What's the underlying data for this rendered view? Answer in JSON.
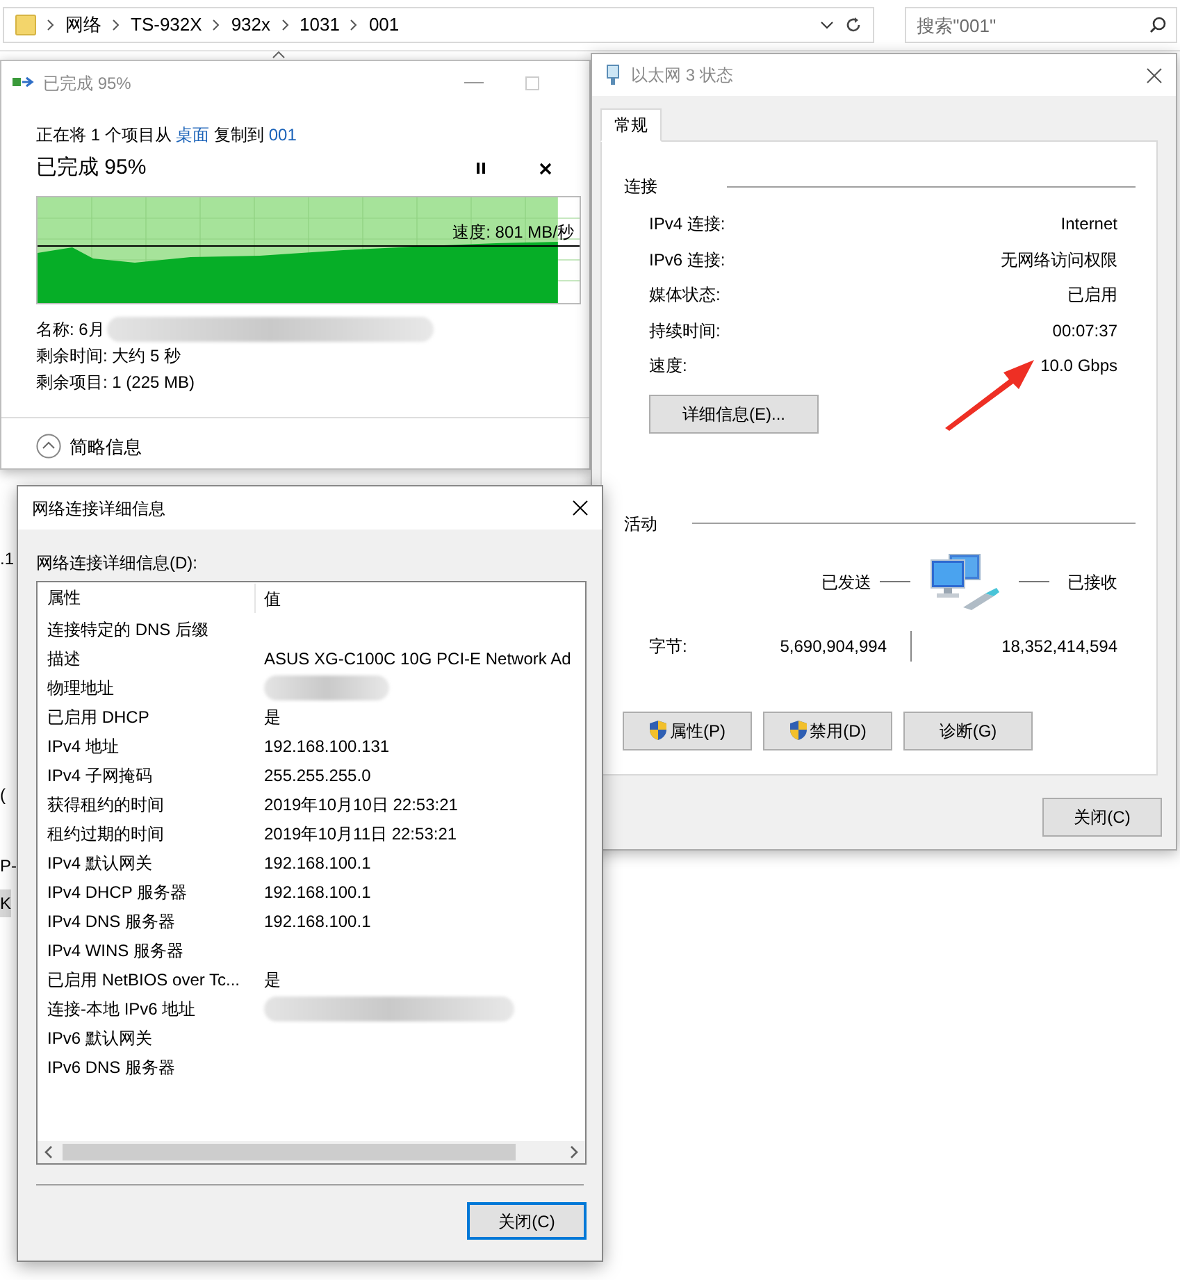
{
  "explorer": {
    "breadcrumb": [
      "网络",
      "TS-932X",
      "932x",
      "1031",
      "001"
    ],
    "search": {
      "placeholder": "搜索\"001\""
    },
    "background_fragments": [
      ".1",
      "(",
      "P-",
      "K"
    ]
  },
  "copy_window": {
    "title": "已完成 95%",
    "copy_line": {
      "prefix": "正在将 1 个项目从",
      "source": "桌面",
      "middle": "复制到",
      "dest": "001"
    },
    "progress_title": "已完成 95%",
    "level": 0.96,
    "speed": "速度: 801 MB/秒",
    "name": "名称: 6月",
    "name_redacted": true,
    "remaining_time": "剩余时间: 大约 5 秒",
    "remaining_items": "剩余项目: 1 (225 MB)",
    "details_toggle": "简略信息"
  },
  "status_window": {
    "title": "以太网 3 状态",
    "tabs": [
      {
        "label": "常规",
        "selected": true
      }
    ],
    "connection": {
      "heading": "连接",
      "rows": [
        {
          "label": "IPv4 连接:",
          "value": "Internet"
        },
        {
          "label": "IPv6 连接:",
          "value": "无网络访问权限"
        },
        {
          "label": "媒体状态:",
          "value": "已启用"
        },
        {
          "label": "持续时间:",
          "value": "00:07:37"
        },
        {
          "label": "速度:",
          "value": "10.0 Gbps"
        }
      ]
    },
    "details_button": "详细信息(E)...",
    "activity": {
      "heading": "活动",
      "sent": "已发送",
      "received": "已接收",
      "bytes_label": "字节:",
      "bytes_sent": "5,690,904,994",
      "bytes_received": "18,352,414,594"
    },
    "buttons": [
      {
        "label": "属性(P)",
        "shield": true
      },
      {
        "label": "禁用(D)",
        "shield": true
      },
      {
        "label": "诊断(G)",
        "shield": false
      }
    ],
    "close_button": "关闭(C)"
  },
  "details_window": {
    "title": "网络连接详细信息",
    "list_label": "网络连接详细信息(D):",
    "columns": [
      "属性",
      "值"
    ],
    "rows": [
      {
        "property": "连接特定的 DNS 后缀",
        "redacted": false
      },
      {
        "property": "描述",
        "value": "ASUS XG-C100C 10G PCI-E Network Ad",
        "redacted": false
      },
      {
        "property": "物理地址",
        "redacted": true
      },
      {
        "property": "已启用 DHCP",
        "value": "是",
        "redacted": false
      },
      {
        "property": "IPv4 地址",
        "value": "192.168.100.131",
        "redacted": false
      },
      {
        "property": "IPv4 子网掩码",
        "value": "255.255.255.0",
        "redacted": false
      },
      {
        "property": "获得租约的时间",
        "value": "2019年10月10日 22:53:21",
        "redacted": false
      },
      {
        "property": "租约过期的时间",
        "value": "2019年10月11日 22:53:21",
        "redacted": false
      },
      {
        "property": "IPv4 默认网关",
        "value": "192.168.100.1",
        "redacted": false
      },
      {
        "property": "IPv4 DHCP 服务器",
        "value": "192.168.100.1",
        "redacted": false
      },
      {
        "property": "IPv4 DNS 服务器",
        "value": "192.168.100.1",
        "redacted": false
      },
      {
        "property": "IPv4 WINS 服务器",
        "redacted": false
      },
      {
        "property": "已启用 NetBIOS over Tc...",
        "value": "是",
        "redacted": false
      },
      {
        "property": "连接-本地 IPv6 地址",
        "redacted": true
      },
      {
        "property": "IPv6 默认网关",
        "redacted": false
      },
      {
        "property": "IPv6 DNS 服务器",
        "redacted": false
      }
    ],
    "close_button": "关闭(C)"
  }
}
